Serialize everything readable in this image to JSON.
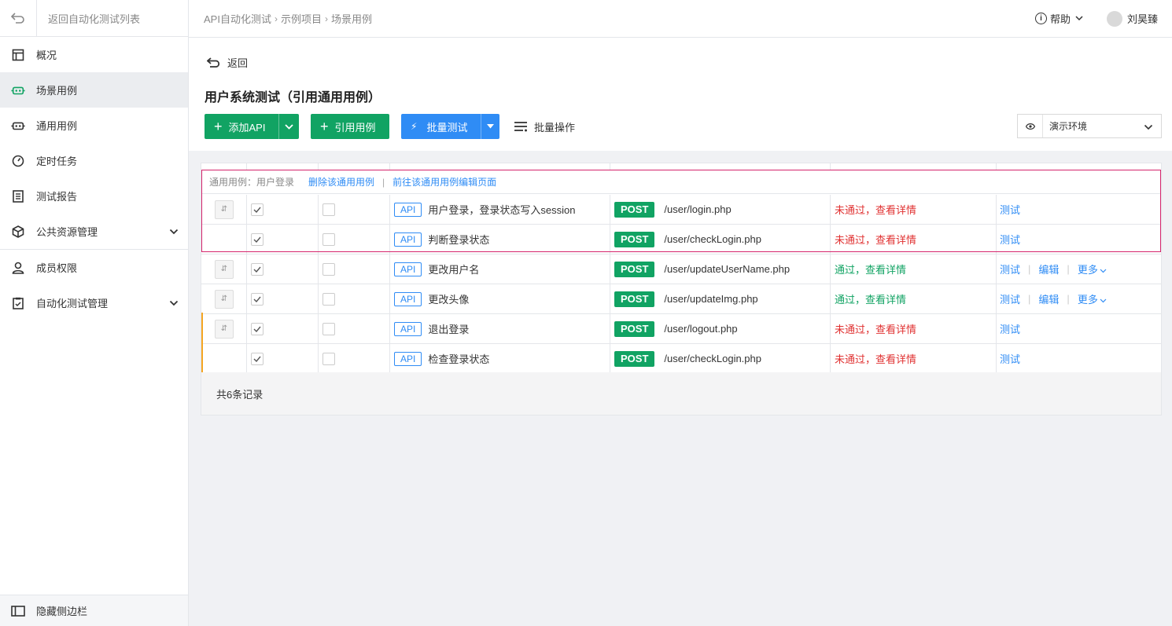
{
  "sidebar": {
    "back_label": "返回自动化测试列表",
    "items": [
      {
        "label": "概况",
        "icon": "overview-icon"
      },
      {
        "label": "场景用例",
        "icon": "robot-icon"
      },
      {
        "label": "通用用例",
        "icon": "robot-icon"
      },
      {
        "label": "定时任务",
        "icon": "timer-icon"
      },
      {
        "label": "测试报告",
        "icon": "report-icon"
      },
      {
        "label": "公共资源管理",
        "icon": "box-icon"
      },
      {
        "label": "成员权限",
        "icon": "user-icon"
      },
      {
        "label": "自动化测试管理",
        "icon": "clipboard-icon"
      }
    ],
    "hide_label": "隐藏侧边栏"
  },
  "topbar": {
    "breadcrumb": [
      "API自动化测试",
      "示例项目",
      "场景用例"
    ],
    "help_label": "帮助",
    "username": "刘昊臻"
  },
  "header": {
    "back_label": "返回",
    "title": "用户系统测试（引用通用用例）",
    "add_api_label": "添加API",
    "ref_case_label": "引用用例",
    "batch_test_label": "批量测试",
    "batch_op_label": "批量操作",
    "env_label": "演示环境"
  },
  "group": {
    "title": "通用用例：用户登录",
    "delete_label": "删除该通用用例",
    "goto_label": "前往该通用用例编辑页面"
  },
  "rows": [
    {
      "tag": "API",
      "name": "用户登录，登录状态写入session",
      "method": "POST",
      "path": "/user/login.php",
      "status": "未通过，查看详情",
      "ops": [
        "测试"
      ]
    },
    {
      "tag": "API",
      "name": "判断登录状态",
      "method": "POST",
      "path": "/user/checkLogin.php",
      "status": "未通过，查看详情",
      "ops": [
        "测试"
      ]
    },
    {
      "tag": "API",
      "name": "更改用户名",
      "method": "POST",
      "path": "/user/updateUserName.php",
      "status": "通过，查看详情",
      "ops": [
        "测试",
        "编辑",
        "更多"
      ]
    },
    {
      "tag": "API",
      "name": "更改头像",
      "method": "POST",
      "path": "/user/updateImg.php",
      "status": "通过，查看详情",
      "ops": [
        "测试",
        "编辑",
        "更多"
      ]
    },
    {
      "tag": "API",
      "name": "退出登录",
      "method": "POST",
      "path": "/user/logout.php",
      "status": "未通过，查看详情",
      "ops": [
        "测试"
      ]
    },
    {
      "tag": "API",
      "name": "检查登录状态",
      "method": "POST",
      "path": "/user/checkLogin.php",
      "status": "未通过，查看详情",
      "ops": [
        "测试"
      ]
    }
  ],
  "footer": {
    "total_label": "共6条记录"
  },
  "colors": {
    "green": "#11a363",
    "blue": "#2f8cf5",
    "red": "#e03131",
    "group_border": "#d5246c",
    "orange": "#f5a623"
  }
}
